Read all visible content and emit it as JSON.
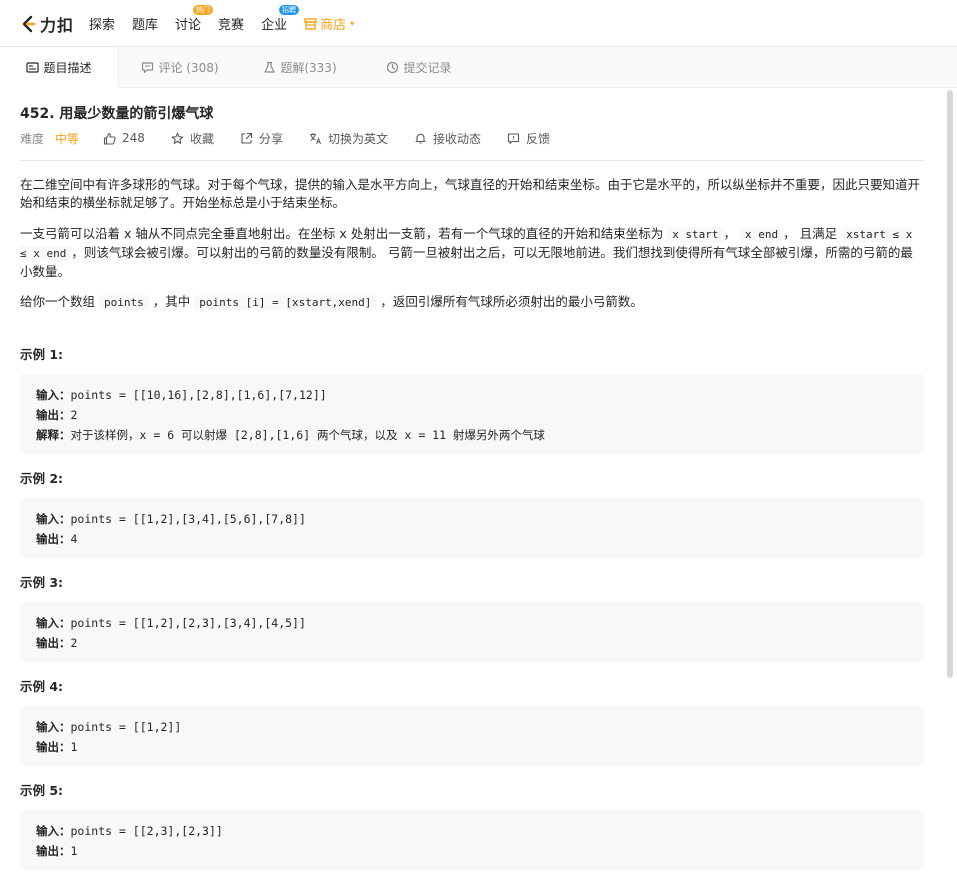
{
  "nav": {
    "logo_text": "力扣",
    "items": [
      {
        "label": "探索"
      },
      {
        "label": "题库"
      },
      {
        "label": "讨论",
        "badge": "热门"
      },
      {
        "label": "竞赛"
      },
      {
        "label": "企业",
        "badge": "招聘"
      }
    ],
    "store_label": "商店",
    "accent_color": "#ffa116"
  },
  "tabs": [
    {
      "label": "题目描述",
      "active": true,
      "icon": "description-icon"
    },
    {
      "label": "评论 (308)",
      "active": false,
      "icon": "comment-icon"
    },
    {
      "label": "题解(333)",
      "active": false,
      "icon": "flask-icon"
    },
    {
      "label": "提交记录",
      "active": false,
      "icon": "history-icon"
    }
  ],
  "problem": {
    "title": "452. 用最少数量的箭引爆气球",
    "difficulty_label": "难度",
    "difficulty": "中等",
    "likes": "248",
    "actions": {
      "collect": "收藏",
      "share": "分享",
      "switch_lang": "切换为英文",
      "notify": "接收动态",
      "feedback": "反馈"
    },
    "p1": "在二维空间中有许多球形的气球。对于每个气球，提供的输入是水平方向上，气球直径的开始和结束坐标。由于它是水平的，所以纵坐标并不重要，因此只要知道开始和结束的横坐标就足够了。开始坐标总是小于结束坐标。",
    "p2_a": "一支弓箭可以沿着 x 轴从不同点完全垂直地射出。在坐标 x 处射出一支箭，若有一个气球的直径的开始和结束坐标为",
    "p2_code1": "x start",
    "p2_sep": "，",
    "p2_code2": "x end",
    "p2_b": "， 且满足",
    "p2_code3": "xstart  ≤ x ≤ x end",
    "p2_c": "，则该气球会被引爆。可以射出的弓箭的数量没有限制。 弓箭一旦被射出之后，可以无限地前进。我们想找到使得所有气球全部被引爆，所需的弓箭的最小数量。",
    "p3_a": "给你一个数组",
    "p3_code1": "points",
    "p3_b": "，其中",
    "p3_code2": "points [i] = [xstart,xend]",
    "p3_c": "，返回引爆所有气球所必须射出的最小弓箭数。"
  },
  "examples": [
    {
      "title": "示例 1:",
      "input_label": "输入：",
      "input": "points = [[10,16],[2,8],[1,6],[7,12]]",
      "output_label": "输出：",
      "output": "2",
      "explain_label": "解释：",
      "explain": "对于该样例，x = 6 可以射爆 [2,8],[1,6] 两个气球，以及 x = 11 射爆另外两个气球"
    },
    {
      "title": "示例 2:",
      "input_label": "输入：",
      "input": "points = [[1,2],[3,4],[5,6],[7,8]]",
      "output_label": "输出：",
      "output": "4"
    },
    {
      "title": "示例 3:",
      "input_label": "输入：",
      "input": "points = [[1,2],[2,3],[3,4],[4,5]]",
      "output_label": "输出：",
      "output": "2"
    },
    {
      "title": "示例 4:",
      "input_label": "输入：",
      "input": "points = [[1,2]]",
      "output_label": "输出：",
      "output": "1"
    },
    {
      "title": "示例 5:",
      "input_label": "输入：",
      "input": "points = [[2,3],[2,3]]",
      "output_label": "输出：",
      "output": "1"
    }
  ]
}
